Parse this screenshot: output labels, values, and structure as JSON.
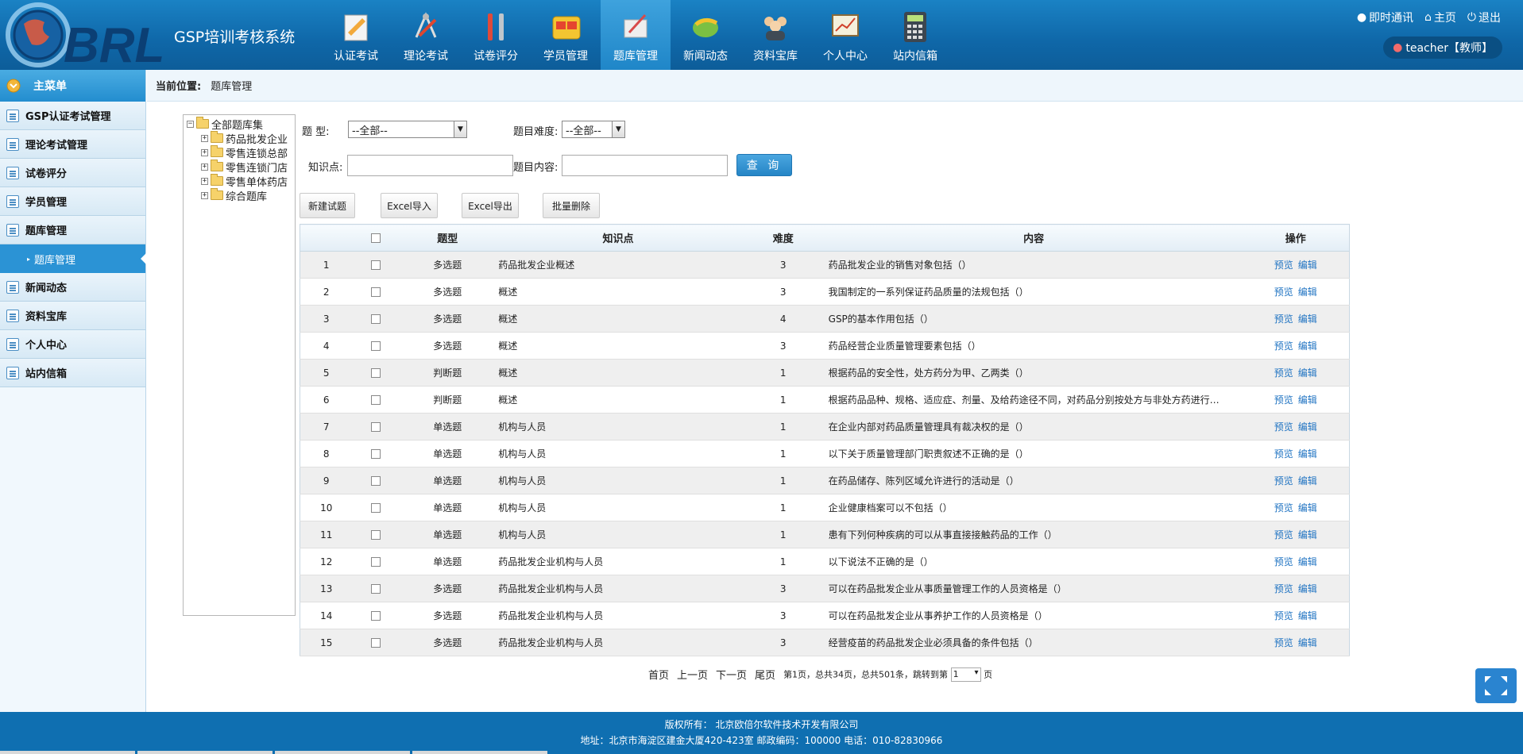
{
  "app": {
    "title": "GSP培训考核系统",
    "logo_text": "BRL"
  },
  "nav": [
    {
      "label": "认证考试",
      "icon": "certificate-exam-icon"
    },
    {
      "label": "理论考试",
      "icon": "theory-exam-icon"
    },
    {
      "label": "试卷评分",
      "icon": "tools-icon"
    },
    {
      "label": "学员管理",
      "icon": "student-folder-icon"
    },
    {
      "label": "题库管理",
      "icon": "question-bank-icon"
    },
    {
      "label": "新闻动态",
      "icon": "news-icon"
    },
    {
      "label": "资料宝库",
      "icon": "people-icon"
    },
    {
      "label": "个人中心",
      "icon": "chart-board-icon"
    },
    {
      "label": "站内信箱",
      "icon": "calculator-icon"
    }
  ],
  "nav_active_index": 4,
  "top_links": {
    "im": "即时通讯",
    "home": "主页",
    "logout": "退出"
  },
  "user": {
    "badge": "teacher【教师】"
  },
  "sidebar": {
    "title": "主菜单",
    "items": [
      {
        "label": "GSP认证考试管理"
      },
      {
        "label": "理论考试管理"
      },
      {
        "label": "试卷评分"
      },
      {
        "label": "学员管理"
      },
      {
        "label": "题库管理"
      },
      {
        "label": "新闻动态"
      },
      {
        "label": "资料宝库"
      },
      {
        "label": "个人中心"
      },
      {
        "label": "站内信箱"
      }
    ],
    "sub_item": "题库管理"
  },
  "breadcrumb": {
    "label": "当前位置:",
    "current": "题库管理"
  },
  "tree": {
    "root": "全部题库集",
    "children": [
      "药品批发企业",
      "零售连锁总部",
      "零售连锁门店",
      "零售单体药店",
      "综合题库"
    ]
  },
  "filters": {
    "type_label": "题    型:",
    "type_value": "--全部--",
    "difficulty_label": "题目难度:",
    "difficulty_value": "--全部--",
    "knowledge_label": "知识点:",
    "knowledge_value": "",
    "content_label": "题目内容:",
    "content_value": "",
    "query_button": "查 询"
  },
  "toolbar": {
    "new": "新建试题",
    "import": "Excel导入",
    "export": "Excel导出",
    "batch_delete": "批量删除"
  },
  "table": {
    "headers": [
      "",
      "",
      "题型",
      "知识点",
      "难度",
      "内容",
      "操作"
    ],
    "op_preview": "预览",
    "op_edit": "编辑",
    "rows": [
      {
        "no": "1",
        "type": "多选题",
        "point": "药品批发企业概述",
        "difficulty": "3",
        "content": "药品批发企业的销售对象包括（）"
      },
      {
        "no": "2",
        "type": "多选题",
        "point": "概述",
        "difficulty": "3",
        "content": "我国制定的一系列保证药品质量的法规包括（）"
      },
      {
        "no": "3",
        "type": "多选题",
        "point": "概述",
        "difficulty": "4",
        "content": "GSP的基本作用包括（）"
      },
      {
        "no": "4",
        "type": "多选题",
        "point": "概述",
        "difficulty": "3",
        "content": "药品经营企业质量管理要素包括（）"
      },
      {
        "no": "5",
        "type": "判断题",
        "point": "概述",
        "difficulty": "1",
        "content": "根据药品的安全性，处方药分为甲、乙两类（）"
      },
      {
        "no": "6",
        "type": "判断题",
        "point": "概述",
        "difficulty": "1",
        "content": "根据药品品种、规格、适应症、剂量、及给药途径不同，对药品分别按处方与非处方药进行…"
      },
      {
        "no": "7",
        "type": "单选题",
        "point": "机构与人员",
        "difficulty": "1",
        "content": "在企业内部对药品质量管理具有裁决权的是（）"
      },
      {
        "no": "8",
        "type": "单选题",
        "point": "机构与人员",
        "difficulty": "1",
        "content": "以下关于质量管理部门职责叙述不正确的是（）"
      },
      {
        "no": "9",
        "type": "单选题",
        "point": "机构与人员",
        "difficulty": "1",
        "content": "在药品储存、陈列区域允许进行的活动是（）"
      },
      {
        "no": "10",
        "type": "单选题",
        "point": "机构与人员",
        "difficulty": "1",
        "content": "企业健康档案可以不包括（）"
      },
      {
        "no": "11",
        "type": "单选题",
        "point": "机构与人员",
        "difficulty": "1",
        "content": "患有下列何种疾病的可以从事直接接触药品的工作（）"
      },
      {
        "no": "12",
        "type": "单选题",
        "point": "药品批发企业机构与人员",
        "difficulty": "1",
        "content": "以下说法不正确的是（）"
      },
      {
        "no": "13",
        "type": "多选题",
        "point": "药品批发企业机构与人员",
        "difficulty": "3",
        "content": "可以在药品批发企业从事质量管理工作的人员资格是（）"
      },
      {
        "no": "14",
        "type": "多选题",
        "point": "药品批发企业机构与人员",
        "difficulty": "3",
        "content": "可以在药品批发企业从事养护工作的人员资格是（）"
      },
      {
        "no": "15",
        "type": "多选题",
        "point": "药品批发企业机构与人员",
        "difficulty": "3",
        "content": "经营疫苗的药品批发企业必须具备的条件包括（）"
      }
    ]
  },
  "pager": {
    "first": "首页",
    "prev": "上一页",
    "next": "下一页",
    "last": "尾页",
    "info": "第1页，总共34页，总共501条，跳转到第",
    "page_value": "1",
    "suffix": "页"
  },
  "footer": {
    "copyright": "版权所有： 北京欧倍尔软件技术开发有限公司",
    "address": "地址：北京市海淀区建金大厦420-423室    邮政编码：100000    电话：010-82830966"
  },
  "colors": {
    "header": "#0f67a8",
    "accent": "#2b93d5",
    "footer": "#0f6fb1",
    "link": "#1f73c2"
  }
}
